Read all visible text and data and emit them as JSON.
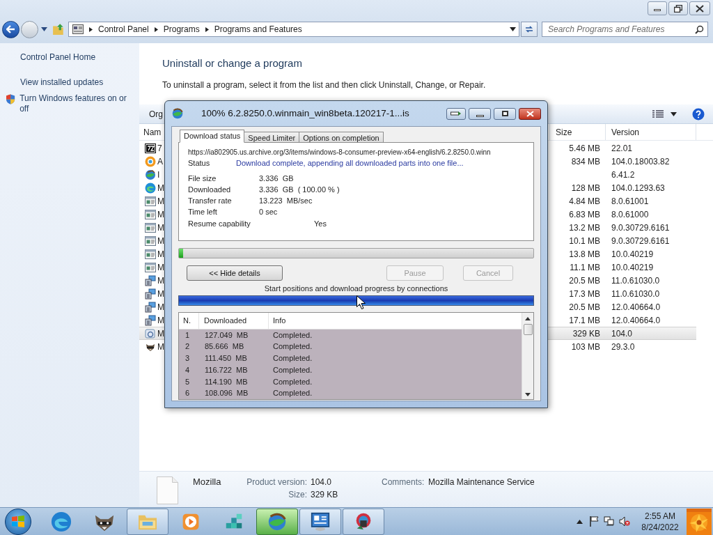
{
  "address_bar": {
    "breadcrumbs": [
      "Control Panel",
      "Programs",
      "Programs and Features"
    ]
  },
  "search": {
    "placeholder": "Search Programs and Features"
  },
  "sidebar": {
    "items": [
      {
        "label": "Control Panel Home",
        "kind": "link"
      },
      {
        "label": "View installed updates",
        "kind": "link"
      },
      {
        "label": "Turn Windows features on or off",
        "kind": "shield"
      }
    ]
  },
  "main": {
    "title": "Uninstall or change a program",
    "description": "To uninstall a program, select it from the list and then click Uninstall, Change, or Repair.",
    "toolbar_label": "Org"
  },
  "program_list": {
    "columns": [
      "Nam",
      "Size",
      "Version"
    ],
    "rows": [
      {
        "kind": "archive",
        "name": "7",
        "size": "5.46 MB",
        "version": "22.01",
        "selected": false
      },
      {
        "kind": "browser",
        "name": "A",
        "size": "834 MB",
        "version": "104.0.18003.82",
        "selected": false
      },
      {
        "kind": "globe",
        "name": "I",
        "version": "6.41.2",
        "selected": false
      },
      {
        "kind": "edge",
        "name": "M",
        "size": "128 MB",
        "version": "104.0.1293.63",
        "selected": false
      },
      {
        "kind": "runtime",
        "name": "M",
        "size": "4.84 MB",
        "version": "8.0.61001",
        "selected": false
      },
      {
        "kind": "runtime",
        "name": "M",
        "size": "6.83 MB",
        "version": "8.0.61000",
        "selected": false
      },
      {
        "kind": "runtime",
        "name": "M",
        "size": "13.2 MB",
        "version": "9.0.30729.6161",
        "selected": false
      },
      {
        "kind": "runtime",
        "name": "M",
        "size": "10.1 MB",
        "version": "9.0.30729.6161",
        "selected": false
      },
      {
        "kind": "runtime",
        "name": "M",
        "size": "13.8 MB",
        "version": "10.0.40219",
        "selected": false
      },
      {
        "kind": "runtime",
        "name": "M",
        "size": "11.1 MB",
        "version": "10.0.40219",
        "selected": false
      },
      {
        "kind": "installer",
        "name": "M",
        "size": "20.5 MB",
        "version": "11.0.61030.0",
        "selected": false
      },
      {
        "kind": "installer",
        "name": "M",
        "size": "17.3 MB",
        "version": "11.0.61030.0",
        "selected": false
      },
      {
        "kind": "installer",
        "name": "M",
        "size": "20.5 MB",
        "version": "12.0.40664.0",
        "selected": false
      },
      {
        "kind": "installer",
        "name": "M",
        "size": "17.1 MB",
        "version": "12.0.40664.0",
        "selected": false
      },
      {
        "kind": "service",
        "name": "M",
        "size": "329 KB",
        "version": "104.0",
        "selected": true
      },
      {
        "kind": "raccoon",
        "name": "M",
        "size": "103 MB",
        "version": "29.3.0",
        "selected": false
      }
    ]
  },
  "details": {
    "name": "Mozilla",
    "product_version_label": "Product version:",
    "product_version": "104.0",
    "size_label": "Size:",
    "size": "329 KB",
    "comments_label": "Comments:",
    "comments": "Mozilla Maintenance Service"
  },
  "dialog": {
    "title": "100% 6.2.8250.0.winmain_win8beta.120217-1...is",
    "tabs": [
      {
        "label": "Download status",
        "selected": true
      },
      {
        "label": "Speed Limiter",
        "selected": false
      },
      {
        "label": "Options on completion",
        "selected": false
      }
    ],
    "url": "https://ia802905.us.archive.org/3/items/windows-8-consumer-preview-x64-english/6.2.8250.0.winn",
    "status_label": "Status",
    "status": "Download complete, appending all downloaded parts into one file...",
    "fields": [
      {
        "label": "File size",
        "value": "3.336  GB"
      },
      {
        "label": "Downloaded",
        "value": "3.336  GB  ( 100.00 % )"
      },
      {
        "label": "Transfer rate",
        "value": "13.223  MB/sec"
      },
      {
        "label": "Time left",
        "value": "0 sec"
      }
    ],
    "resume_label": "Resume capability",
    "resume": "Yes",
    "progress": {
      "level": 0.01
    },
    "buttons": [
      {
        "label": "<< Hide details",
        "disabled": false
      },
      {
        "label": "Pause",
        "disabled": true
      },
      {
        "label": "Cancel",
        "disabled": true
      }
    ],
    "connections_caption": "Start positions and download progress by connections",
    "connections": {
      "columns": [
        "N.",
        "Downloaded",
        "Info"
      ],
      "rows": [
        {
          "n": "1",
          "downloaded": "127.049  MB",
          "info": "Completed."
        },
        {
          "n": "2",
          "downloaded": "85.666  MB",
          "info": "Completed."
        },
        {
          "n": "3",
          "downloaded": "111.450  MB",
          "info": "Completed."
        },
        {
          "n": "4",
          "downloaded": "116.722  MB",
          "info": "Completed."
        },
        {
          "n": "5",
          "downloaded": "114.190  MB",
          "info": "Completed."
        },
        {
          "n": "6",
          "downloaded": "108.096  MB",
          "info": "Completed."
        }
      ]
    }
  },
  "taskbar": {
    "buttons": [
      {
        "kind": "edge",
        "running": false,
        "selected": false
      },
      {
        "kind": "raccoon",
        "running": false,
        "selected": false
      },
      {
        "kind": "explorer",
        "running": true,
        "selected": false
      },
      {
        "kind": "media",
        "running": false,
        "selected": false
      },
      {
        "kind": "cubes",
        "running": false,
        "selected": false
      },
      {
        "kind": "globe",
        "running": true,
        "selected": true
      },
      {
        "kind": "panel",
        "running": true,
        "selected": false
      },
      {
        "kind": "tool",
        "running": true,
        "selected": false
      }
    ],
    "speaker_muted": true,
    "time": "2:55 AM",
    "date": "8/24/2022"
  }
}
